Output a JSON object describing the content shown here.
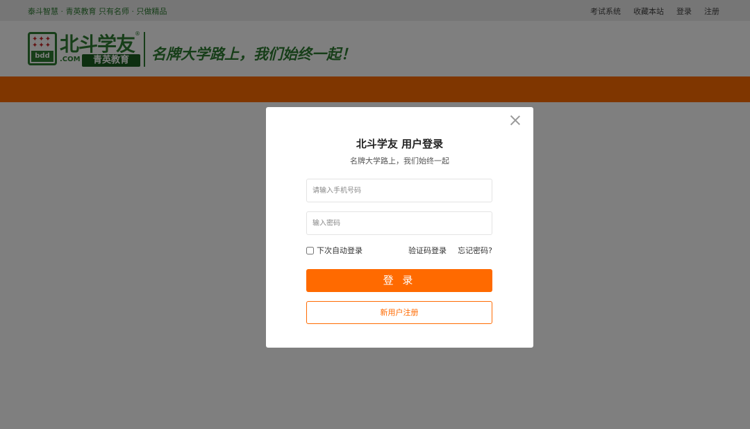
{
  "topbar": {
    "slogan": "泰斗智慧 · 青英教育   只有名师 · 只做精品",
    "links": [
      "考试系统",
      "收藏本站",
      "登录",
      "注册"
    ]
  },
  "header": {
    "logo_text": "北斗学友",
    "logo_domain": ".COM",
    "logo_sub": "青英教育",
    "logo_mark": "®",
    "motto": "名牌大学路上，我们始终一起！"
  },
  "modal": {
    "title": "北斗学友 用户登录",
    "subtitle": "名牌大学路上，我们始终一起",
    "phone_placeholder": "请输入手机号码",
    "password_placeholder": "输入密码",
    "remember_label": "下次自动登录",
    "sms_login": "验证码登录",
    "forgot": "忘记密码?",
    "login_button": "登 录",
    "register_button": "新用户注册"
  },
  "colors": {
    "brand_green": "#2e7d32",
    "accent_orange": "#ff6a00"
  }
}
